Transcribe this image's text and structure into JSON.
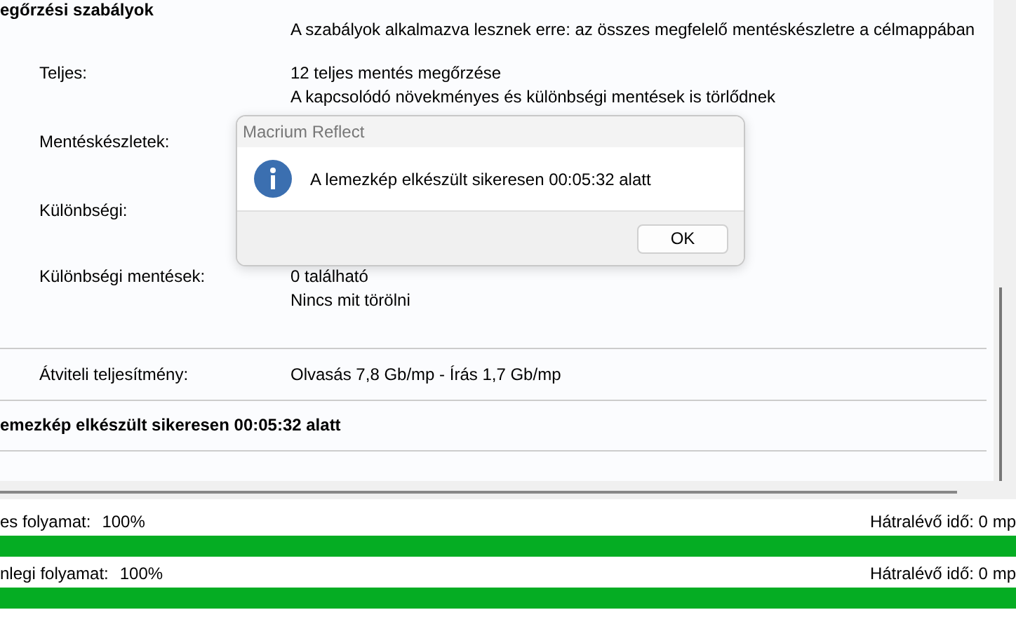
{
  "report": {
    "section_title": "egőrzési szabályok",
    "intro": "A szabályok alkalmazva lesznek erre: az összes megfelelő mentéskészletre a célmappában",
    "rows": [
      {
        "label": "Teljes:",
        "values": [
          "12 teljes mentés megőrzése",
          "A kapcsolódó növekményes és különbségi mentések is törlődnek"
        ]
      },
      {
        "label": "Mentéskészletek:",
        "values": []
      },
      {
        "label": "Különbségi:",
        "values": []
      },
      {
        "label": "Különbségi mentések:",
        "values": [
          "0 található",
          "Nincs mit törölni"
        ]
      }
    ],
    "throughput": {
      "label": "Átviteli teljesítmény:",
      "value": "Olvasás 7,8 Gb/mp - Írás 1,7 Gb/mp"
    },
    "result": "emezkép elkészült sikeresen 00:05:32 alatt"
  },
  "dialog": {
    "title": "Macrium Reflect",
    "message": "A lemezkép elkészült sikeresen 00:05:32 alatt",
    "button": "OK"
  },
  "progress": [
    {
      "label": "es folyamat:",
      "percent": "100%",
      "remaining": "Hátralévő idő: 0 mp",
      "level": 1
    },
    {
      "label": "nlegi folyamat:",
      "percent": "100%",
      "remaining": "Hátralévő idő: 0 mp",
      "level": 1
    }
  ]
}
